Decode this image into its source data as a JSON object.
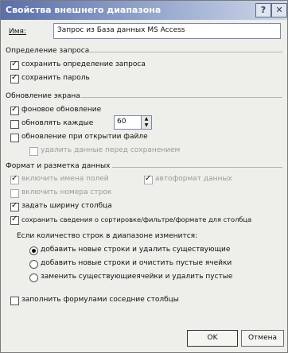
{
  "title": "Свойства внешнего диапазона",
  "title_buttons": {
    "help": "?",
    "close": "✕"
  },
  "name_label": "Имя:",
  "name_value": "Запрос из База данных MS Access",
  "sections": {
    "query_def": "Определение запроса",
    "refresh": "Обновление экрана",
    "format": "Формат и разметка данных"
  },
  "query": {
    "save_definition": "сохранить определение запроса",
    "save_password": "сохранить пароль"
  },
  "refresh": {
    "background": "фоновое обновление",
    "every": "обновлять каждые",
    "every_value": "60",
    "on_open": "обновление при открытии файле",
    "remove_data": "удалить данные перед сохранением"
  },
  "format": {
    "field_names": "включить имена полей",
    "row_numbers": "включить номера строк",
    "column_width": "задать ширину столбца",
    "preserve": "сохранить сведения о сортировке/фильтре/формате для столбца",
    "autoformat": "автоформат данных",
    "rows_change_label": "Если количество строк в диапазоне изменится:",
    "opt_insert": "добавить новые строки и удалить существующие",
    "opt_clear": "добавить новые строки и очистить пустые ячейки",
    "opt_overwrite": "заменить существующиеячейки и удалить пустые",
    "fill_formulas": "заполнить формулами соседние столбцы"
  },
  "buttons": {
    "ok": "OK",
    "cancel": "Отмена"
  }
}
